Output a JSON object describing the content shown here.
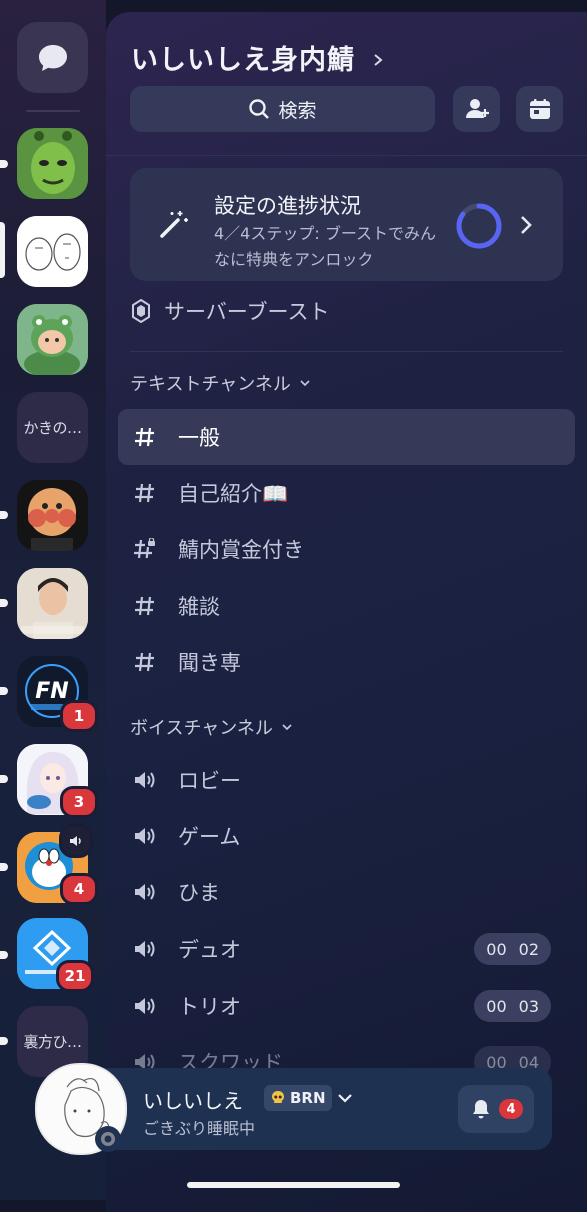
{
  "colors": {
    "accent": "#5865f2",
    "badge": "#da373c",
    "bg": "#141629"
  },
  "rail": {
    "servers": [
      {
        "name": "server-frog-face"
      },
      {
        "name": "server-sticker"
      },
      {
        "name": "server-frog-cat"
      },
      {
        "name": "server-text-1",
        "label": "かきの…"
      },
      {
        "name": "server-round-face"
      },
      {
        "name": "server-person"
      },
      {
        "name": "server-fn",
        "badge": "1"
      },
      {
        "name": "server-anime",
        "badge": "3"
      },
      {
        "name": "server-doraemon",
        "badge": "4"
      },
      {
        "name": "server-izumi",
        "badge": "21"
      },
      {
        "name": "server-text-2",
        "label": "裏方ひ…"
      }
    ]
  },
  "header": {
    "server_name": "いしいしえ身内鯖",
    "search_label": "検索"
  },
  "progress": {
    "title": "設定の進捗状況",
    "subtitle": "4／4ステップ: ブーストでみんなに特典をアンロック",
    "fraction": 0.85
  },
  "boost": {
    "label": "サーバーブースト"
  },
  "text_category": {
    "label": "テキストチャンネル"
  },
  "text_channels": [
    {
      "name": "一般",
      "active": true
    },
    {
      "name": "自己紹介📖"
    },
    {
      "name": "鯖内賞金付き",
      "locked": true
    },
    {
      "name": "雑談"
    },
    {
      "name": "聞き専"
    }
  ],
  "voice_category": {
    "label": "ボイスチャンネル"
  },
  "voice_channels": [
    {
      "name": "ロビー"
    },
    {
      "name": "ゲーム"
    },
    {
      "name": "ひま"
    },
    {
      "name": "デュオ",
      "count": "00",
      "limit": "02"
    },
    {
      "name": "トリオ",
      "count": "00",
      "limit": "03"
    },
    {
      "name": "スクワッド",
      "count": "00",
      "limit": "04"
    }
  ],
  "user": {
    "name": "いしいしえ",
    "tag": "BRN",
    "status": "ごきぶり睡眠中",
    "notifications": "4"
  }
}
